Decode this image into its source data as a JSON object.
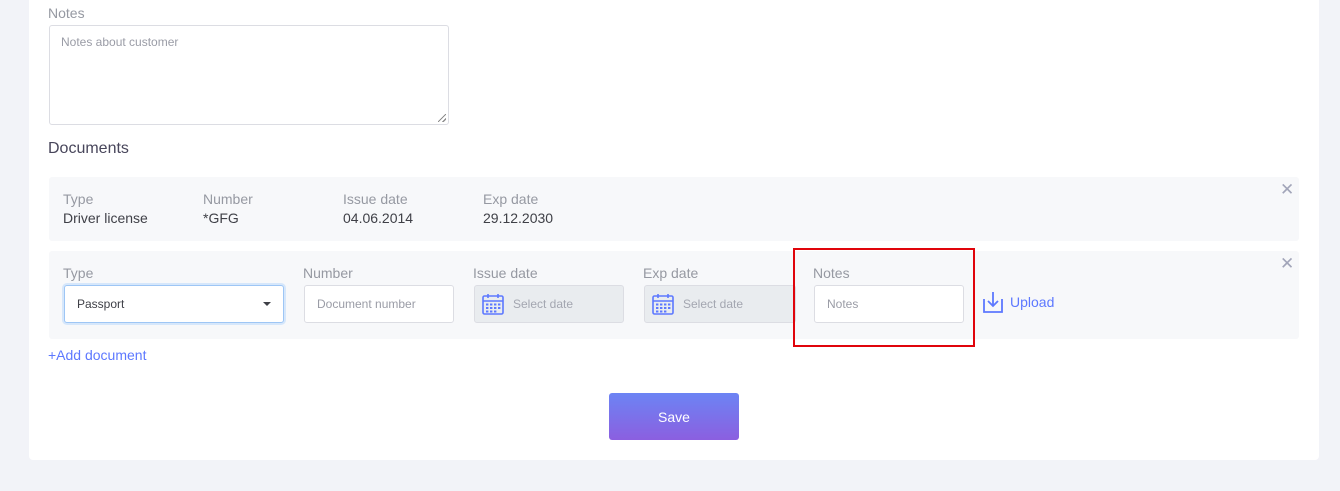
{
  "customer_notes": {
    "label": "Notes",
    "placeholder": "Notes about customer"
  },
  "documents": {
    "title": "Documents",
    "saved": {
      "headers": {
        "type": "Type",
        "number": "Number",
        "issue_date": "Issue date",
        "exp_date": "Exp date"
      },
      "values": {
        "type": "Driver license",
        "number": "*GFG",
        "issue_date": "04.06.2014",
        "exp_date": "29.12.2030"
      },
      "close": "✕"
    },
    "new": {
      "headers": {
        "type": "Type",
        "number": "Number",
        "issue_date": "Issue date",
        "exp_date": "Exp date",
        "notes": "Notes"
      },
      "type_value": "Passport",
      "number_placeholder": "Document number",
      "issue_date_placeholder": "Select date",
      "exp_date_placeholder": "Select date",
      "notes_placeholder": "Notes",
      "upload_label": "Upload",
      "close": "✕"
    },
    "add_label": "+Add document"
  },
  "save_label": "Save",
  "colors": {
    "accent": "#5d78ff",
    "highlight": "#e0040b",
    "button_gradient_top": "#6c84f4",
    "button_gradient_bottom": "#8b5fe0"
  },
  "icons": {
    "calendar": "calendar-icon",
    "upload": "upload-icon",
    "close": "close-icon",
    "caret": "chevron-down-icon"
  }
}
